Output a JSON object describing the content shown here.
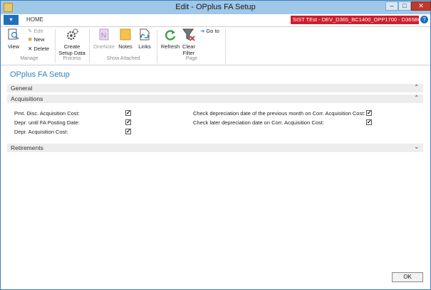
{
  "window": {
    "title": "Edit - OPplus FA Setup"
  },
  "tabs": {
    "file_glyph": "▾",
    "home": "HOME"
  },
  "environment": {
    "badge": "SIST TEst - DEV_D365_BC1400_OPP1700 - D365BC14...",
    "help_glyph": "?"
  },
  "ribbon": {
    "manage": {
      "view": "View",
      "edit": "Edit",
      "new": "New",
      "delete": "Delete",
      "group": "Manage"
    },
    "process": {
      "create_setup_data_1": "Create",
      "create_setup_data_2": "Setup Data",
      "group": "Process"
    },
    "show_attached": {
      "onenote": "OneNote",
      "notes": "Notes",
      "links": "Links",
      "group": "Show Attached"
    },
    "page": {
      "refresh": "Refresh",
      "clear_filter_1": "Clear",
      "clear_filter_2": "Filter",
      "goto": "Go to",
      "group": "Page"
    }
  },
  "page_title": "OPplus FA Setup",
  "sections": {
    "general": "General",
    "acquisitions": "Acquisitions",
    "retirements": "Retirements"
  },
  "fields": {
    "pmt_disc": {
      "label": "Pmt. Disc. Acquisition Cost:",
      "checked": "✓"
    },
    "depr_until": {
      "label": "Depr. until FA Posting Date:",
      "checked": "✓"
    },
    "depr_acq": {
      "label": "Depr. Acquisition Cost:",
      "checked": "✓"
    },
    "check_prev": {
      "label": "Check depreciation date of the previous month on Corr. Acquisition Cost:",
      "checked": "✓"
    },
    "check_later": {
      "label": "Check later depreciation date on Corr. Acquisition Cost:",
      "checked": "✓"
    }
  },
  "footer": {
    "ok": "OK"
  },
  "colors": {
    "accent": "#2f7fbf",
    "env_badge": "#cc1f2d",
    "titlebar": "#9fc7e8"
  }
}
